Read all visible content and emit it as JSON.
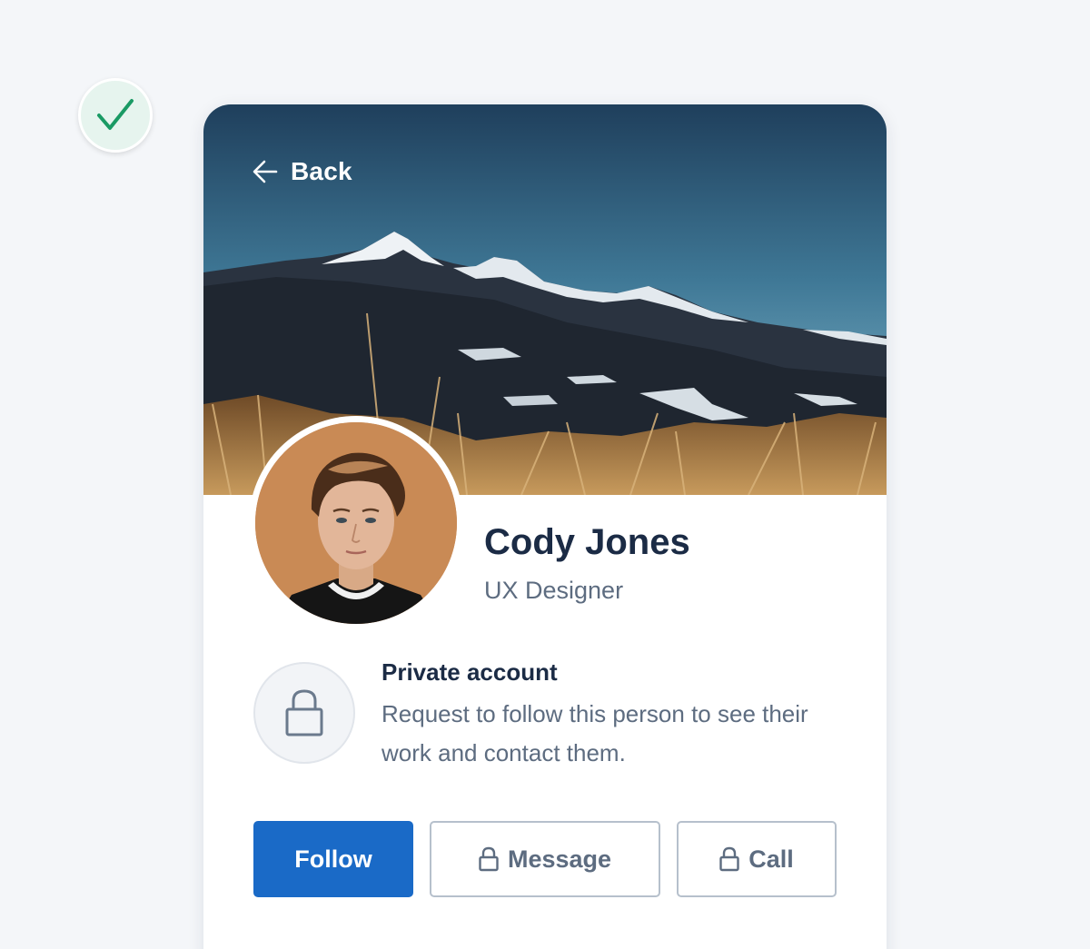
{
  "header": {
    "back_label": "Back"
  },
  "profile": {
    "name": "Cody Jones",
    "role": "UX Designer"
  },
  "privacy": {
    "title": "Private account",
    "description": "Request to follow this person to see their work and contact them."
  },
  "actions": {
    "follow_label": "Follow",
    "message_label": "Message",
    "call_label": "Call"
  },
  "icons": {
    "status": "checkmark-icon",
    "back": "arrow-left-icon",
    "privacy": "lock-icon",
    "message_lock": "lock-icon",
    "call_lock": "lock-icon"
  },
  "colors": {
    "primary": "#1a6ac7",
    "heading": "#1b2b45",
    "muted": "#5d6c80",
    "success": "#1a9a64",
    "button_border": "#b6c0cc"
  }
}
